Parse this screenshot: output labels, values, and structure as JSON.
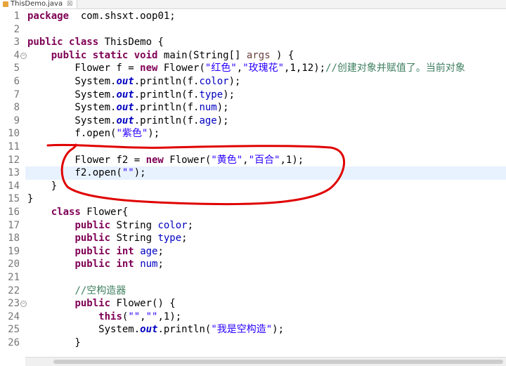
{
  "tab": {
    "title": "ThisDemo.java",
    "close_glyph": "☒",
    "icon": "java-file-icon"
  },
  "colors": {
    "keyword": "#7f0055",
    "string": "#2a00ff",
    "field": "#0000c0",
    "comment": "#3f7f5f",
    "annotation": "#e00000"
  },
  "lines": [
    {
      "n": "1",
      "t": [
        [
          "kw",
          "package"
        ],
        [
          "",
          "  com.shsxt.oop01;"
        ]
      ]
    },
    {
      "n": "2",
      "t": []
    },
    {
      "n": "3",
      "t": [
        [
          "kw",
          "public"
        ],
        [
          "",
          " "
        ],
        [
          "kw",
          "class"
        ],
        [
          "",
          " ThisDemo {"
        ]
      ]
    },
    {
      "n": "4",
      "fold": true,
      "t": [
        [
          "",
          "    "
        ],
        [
          "kw",
          "public"
        ],
        [
          "",
          " "
        ],
        [
          "kw",
          "static"
        ],
        [
          "",
          " "
        ],
        [
          "kw",
          "void"
        ],
        [
          "",
          " main(String[] "
        ],
        [
          "par",
          "args"
        ],
        [
          "",
          " ) {"
        ]
      ]
    },
    {
      "n": "5",
      "t": [
        [
          "",
          "        Flower f = "
        ],
        [
          "kw",
          "new"
        ],
        [
          "",
          " Flower("
        ],
        [
          "str",
          "\"红色\""
        ],
        [
          "",
          ","
        ],
        [
          "str",
          "\"玫瑰花\""
        ],
        [
          "",
          ",1,12);"
        ],
        [
          "cmt",
          "//创建对象并赋值了。当前对象"
        ]
      ]
    },
    {
      "n": "6",
      "t": [
        [
          "",
          "        System."
        ],
        [
          "fldi",
          "out"
        ],
        [
          "",
          ".println(f."
        ],
        [
          "fld",
          "color"
        ],
        [
          "",
          ");"
        ]
      ]
    },
    {
      "n": "7",
      "t": [
        [
          "",
          "        System."
        ],
        [
          "fldi",
          "out"
        ],
        [
          "",
          ".println(f."
        ],
        [
          "fld",
          "type"
        ],
        [
          "",
          ");"
        ]
      ]
    },
    {
      "n": "8",
      "t": [
        [
          "",
          "        System."
        ],
        [
          "fldi",
          "out"
        ],
        [
          "",
          ".println(f."
        ],
        [
          "fld",
          "num"
        ],
        [
          "",
          ");"
        ]
      ]
    },
    {
      "n": "9",
      "t": [
        [
          "",
          "        System."
        ],
        [
          "fldi",
          "out"
        ],
        [
          "",
          ".println(f."
        ],
        [
          "fld",
          "age"
        ],
        [
          "",
          ");"
        ]
      ]
    },
    {
      "n": "10",
      "t": [
        [
          "",
          "        f.open("
        ],
        [
          "str",
          "\"紫色\""
        ],
        [
          "",
          ");"
        ]
      ]
    },
    {
      "n": "11",
      "t": []
    },
    {
      "n": "12",
      "t": [
        [
          "",
          "        Flower f2 = "
        ],
        [
          "kw",
          "new"
        ],
        [
          "",
          " Flower("
        ],
        [
          "str",
          "\"黄色\""
        ],
        [
          "",
          ","
        ],
        [
          "str",
          "\"百合\""
        ],
        [
          "",
          ",1);"
        ]
      ]
    },
    {
      "n": "13",
      "t": [
        [
          "",
          "        f2.open("
        ],
        [
          "str",
          "\"\""
        ],
        [
          "",
          ");"
        ]
      ]
    },
    {
      "n": "14",
      "t": [
        [
          "",
          "    }"
        ]
      ]
    },
    {
      "n": "15",
      "t": [
        [
          "",
          "}"
        ]
      ]
    },
    {
      "n": "16",
      "t": [
        [
          "",
          "    "
        ],
        [
          "kw",
          "class"
        ],
        [
          "",
          " Flower{"
        ]
      ]
    },
    {
      "n": "17",
      "t": [
        [
          "",
          "        "
        ],
        [
          "kw",
          "public"
        ],
        [
          "",
          " String "
        ],
        [
          "fld",
          "color"
        ],
        [
          "",
          ";"
        ]
      ]
    },
    {
      "n": "18",
      "t": [
        [
          "",
          "        "
        ],
        [
          "kw",
          "public"
        ],
        [
          "",
          " String "
        ],
        [
          "fld",
          "type"
        ],
        [
          "",
          ";"
        ]
      ]
    },
    {
      "n": "19",
      "t": [
        [
          "",
          "        "
        ],
        [
          "kw",
          "public"
        ],
        [
          "",
          " "
        ],
        [
          "kw",
          "int"
        ],
        [
          "",
          " "
        ],
        [
          "fld",
          "age"
        ],
        [
          "",
          ";"
        ]
      ]
    },
    {
      "n": "20",
      "t": [
        [
          "",
          "        "
        ],
        [
          "kw",
          "public"
        ],
        [
          "",
          " "
        ],
        [
          "kw",
          "int"
        ],
        [
          "",
          " "
        ],
        [
          "fld",
          "num"
        ],
        [
          "",
          ";"
        ]
      ]
    },
    {
      "n": "21",
      "t": []
    },
    {
      "n": "22",
      "t": [
        [
          "",
          "        "
        ],
        [
          "cmt",
          "//空构造器"
        ]
      ]
    },
    {
      "n": "23",
      "fold": true,
      "t": [
        [
          "",
          "        "
        ],
        [
          "kw",
          "public"
        ],
        [
          "",
          " Flower() {"
        ]
      ]
    },
    {
      "n": "24",
      "t": [
        [
          "",
          "            "
        ],
        [
          "kw",
          "this"
        ],
        [
          "",
          "("
        ],
        [
          "str",
          "\"\""
        ],
        [
          "",
          ","
        ],
        [
          "str",
          "\"\""
        ],
        [
          "",
          ",1);"
        ]
      ]
    },
    {
      "n": "25",
      "t": [
        [
          "",
          "            System."
        ],
        [
          "fldi",
          "out"
        ],
        [
          "",
          ".println("
        ],
        [
          "str",
          "\"我是空构造\""
        ],
        [
          "",
          ");"
        ]
      ]
    },
    {
      "n": "26",
      "t": [
        [
          "",
          "        }"
        ]
      ]
    }
  ],
  "highlighted_line": "13"
}
